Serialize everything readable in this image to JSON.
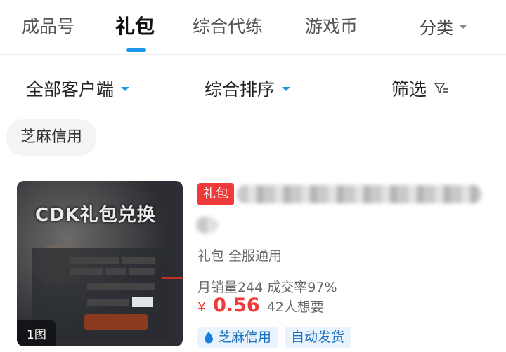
{
  "tabs": [
    {
      "label": "成品号",
      "active": false
    },
    {
      "label": "礼包",
      "active": true
    },
    {
      "label": "综合代练",
      "active": false
    },
    {
      "label": "游戏币",
      "active": false
    }
  ],
  "category": {
    "label": "分类",
    "icon": "chevron-down-icon"
  },
  "filters": {
    "client": "全部客户端",
    "sort": "综合排序",
    "filter": "筛选",
    "filter_icon": "funnel-icon"
  },
  "chip": "芝麻信用",
  "product": {
    "image_title": "CDK礼包兑换",
    "image_count": "1图",
    "badge": "礼包",
    "subtitle": "礼包  全服通用",
    "sales": "月销量244 成交率97%",
    "currency": "¥",
    "price": "0.56",
    "want": "42人想要",
    "tags": [
      "芝麻信用",
      "自动发货"
    ],
    "tag_icon": "droplet-icon"
  },
  "colors": {
    "accent": "#1a97e6",
    "price": "#ef3a3a",
    "tag_bg": "#eaf4fe"
  }
}
